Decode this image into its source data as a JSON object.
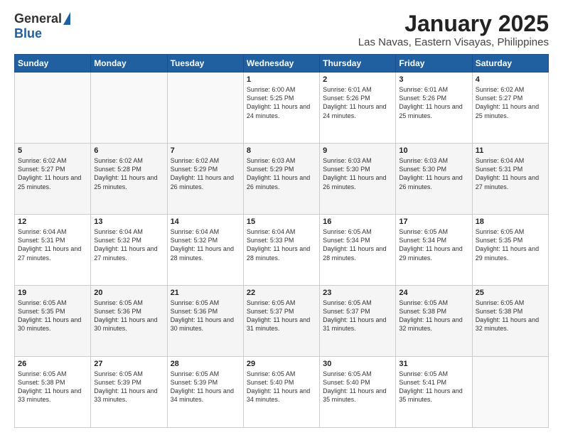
{
  "logo": {
    "general": "General",
    "blue": "Blue"
  },
  "title": "January 2025",
  "subtitle": "Las Navas, Eastern Visayas, Philippines",
  "days_of_week": [
    "Sunday",
    "Monday",
    "Tuesday",
    "Wednesday",
    "Thursday",
    "Friday",
    "Saturday"
  ],
  "weeks": [
    [
      {
        "num": "",
        "sunrise": "",
        "sunset": "",
        "daylight": ""
      },
      {
        "num": "",
        "sunrise": "",
        "sunset": "",
        "daylight": ""
      },
      {
        "num": "",
        "sunrise": "",
        "sunset": "",
        "daylight": ""
      },
      {
        "num": "1",
        "sunrise": "Sunrise: 6:00 AM",
        "sunset": "Sunset: 5:25 PM",
        "daylight": "Daylight: 11 hours and 24 minutes."
      },
      {
        "num": "2",
        "sunrise": "Sunrise: 6:01 AM",
        "sunset": "Sunset: 5:26 PM",
        "daylight": "Daylight: 11 hours and 24 minutes."
      },
      {
        "num": "3",
        "sunrise": "Sunrise: 6:01 AM",
        "sunset": "Sunset: 5:26 PM",
        "daylight": "Daylight: 11 hours and 25 minutes."
      },
      {
        "num": "4",
        "sunrise": "Sunrise: 6:02 AM",
        "sunset": "Sunset: 5:27 PM",
        "daylight": "Daylight: 11 hours and 25 minutes."
      }
    ],
    [
      {
        "num": "5",
        "sunrise": "Sunrise: 6:02 AM",
        "sunset": "Sunset: 5:27 PM",
        "daylight": "Daylight: 11 hours and 25 minutes."
      },
      {
        "num": "6",
        "sunrise": "Sunrise: 6:02 AM",
        "sunset": "Sunset: 5:28 PM",
        "daylight": "Daylight: 11 hours and 25 minutes."
      },
      {
        "num": "7",
        "sunrise": "Sunrise: 6:02 AM",
        "sunset": "Sunset: 5:29 PM",
        "daylight": "Daylight: 11 hours and 26 minutes."
      },
      {
        "num": "8",
        "sunrise": "Sunrise: 6:03 AM",
        "sunset": "Sunset: 5:29 PM",
        "daylight": "Daylight: 11 hours and 26 minutes."
      },
      {
        "num": "9",
        "sunrise": "Sunrise: 6:03 AM",
        "sunset": "Sunset: 5:30 PM",
        "daylight": "Daylight: 11 hours and 26 minutes."
      },
      {
        "num": "10",
        "sunrise": "Sunrise: 6:03 AM",
        "sunset": "Sunset: 5:30 PM",
        "daylight": "Daylight: 11 hours and 26 minutes."
      },
      {
        "num": "11",
        "sunrise": "Sunrise: 6:04 AM",
        "sunset": "Sunset: 5:31 PM",
        "daylight": "Daylight: 11 hours and 27 minutes."
      }
    ],
    [
      {
        "num": "12",
        "sunrise": "Sunrise: 6:04 AM",
        "sunset": "Sunset: 5:31 PM",
        "daylight": "Daylight: 11 hours and 27 minutes."
      },
      {
        "num": "13",
        "sunrise": "Sunrise: 6:04 AM",
        "sunset": "Sunset: 5:32 PM",
        "daylight": "Daylight: 11 hours and 27 minutes."
      },
      {
        "num": "14",
        "sunrise": "Sunrise: 6:04 AM",
        "sunset": "Sunset: 5:32 PM",
        "daylight": "Daylight: 11 hours and 28 minutes."
      },
      {
        "num": "15",
        "sunrise": "Sunrise: 6:04 AM",
        "sunset": "Sunset: 5:33 PM",
        "daylight": "Daylight: 11 hours and 28 minutes."
      },
      {
        "num": "16",
        "sunrise": "Sunrise: 6:05 AM",
        "sunset": "Sunset: 5:34 PM",
        "daylight": "Daylight: 11 hours and 28 minutes."
      },
      {
        "num": "17",
        "sunrise": "Sunrise: 6:05 AM",
        "sunset": "Sunset: 5:34 PM",
        "daylight": "Daylight: 11 hours and 29 minutes."
      },
      {
        "num": "18",
        "sunrise": "Sunrise: 6:05 AM",
        "sunset": "Sunset: 5:35 PM",
        "daylight": "Daylight: 11 hours and 29 minutes."
      }
    ],
    [
      {
        "num": "19",
        "sunrise": "Sunrise: 6:05 AM",
        "sunset": "Sunset: 5:35 PM",
        "daylight": "Daylight: 11 hours and 30 minutes."
      },
      {
        "num": "20",
        "sunrise": "Sunrise: 6:05 AM",
        "sunset": "Sunset: 5:36 PM",
        "daylight": "Daylight: 11 hours and 30 minutes."
      },
      {
        "num": "21",
        "sunrise": "Sunrise: 6:05 AM",
        "sunset": "Sunset: 5:36 PM",
        "daylight": "Daylight: 11 hours and 30 minutes."
      },
      {
        "num": "22",
        "sunrise": "Sunrise: 6:05 AM",
        "sunset": "Sunset: 5:37 PM",
        "daylight": "Daylight: 11 hours and 31 minutes."
      },
      {
        "num": "23",
        "sunrise": "Sunrise: 6:05 AM",
        "sunset": "Sunset: 5:37 PM",
        "daylight": "Daylight: 11 hours and 31 minutes."
      },
      {
        "num": "24",
        "sunrise": "Sunrise: 6:05 AM",
        "sunset": "Sunset: 5:38 PM",
        "daylight": "Daylight: 11 hours and 32 minutes."
      },
      {
        "num": "25",
        "sunrise": "Sunrise: 6:05 AM",
        "sunset": "Sunset: 5:38 PM",
        "daylight": "Daylight: 11 hours and 32 minutes."
      }
    ],
    [
      {
        "num": "26",
        "sunrise": "Sunrise: 6:05 AM",
        "sunset": "Sunset: 5:38 PM",
        "daylight": "Daylight: 11 hours and 33 minutes."
      },
      {
        "num": "27",
        "sunrise": "Sunrise: 6:05 AM",
        "sunset": "Sunset: 5:39 PM",
        "daylight": "Daylight: 11 hours and 33 minutes."
      },
      {
        "num": "28",
        "sunrise": "Sunrise: 6:05 AM",
        "sunset": "Sunset: 5:39 PM",
        "daylight": "Daylight: 11 hours and 34 minutes."
      },
      {
        "num": "29",
        "sunrise": "Sunrise: 6:05 AM",
        "sunset": "Sunset: 5:40 PM",
        "daylight": "Daylight: 11 hours and 34 minutes."
      },
      {
        "num": "30",
        "sunrise": "Sunrise: 6:05 AM",
        "sunset": "Sunset: 5:40 PM",
        "daylight": "Daylight: 11 hours and 35 minutes."
      },
      {
        "num": "31",
        "sunrise": "Sunrise: 6:05 AM",
        "sunset": "Sunset: 5:41 PM",
        "daylight": "Daylight: 11 hours and 35 minutes."
      },
      {
        "num": "",
        "sunrise": "",
        "sunset": "",
        "daylight": ""
      }
    ]
  ]
}
